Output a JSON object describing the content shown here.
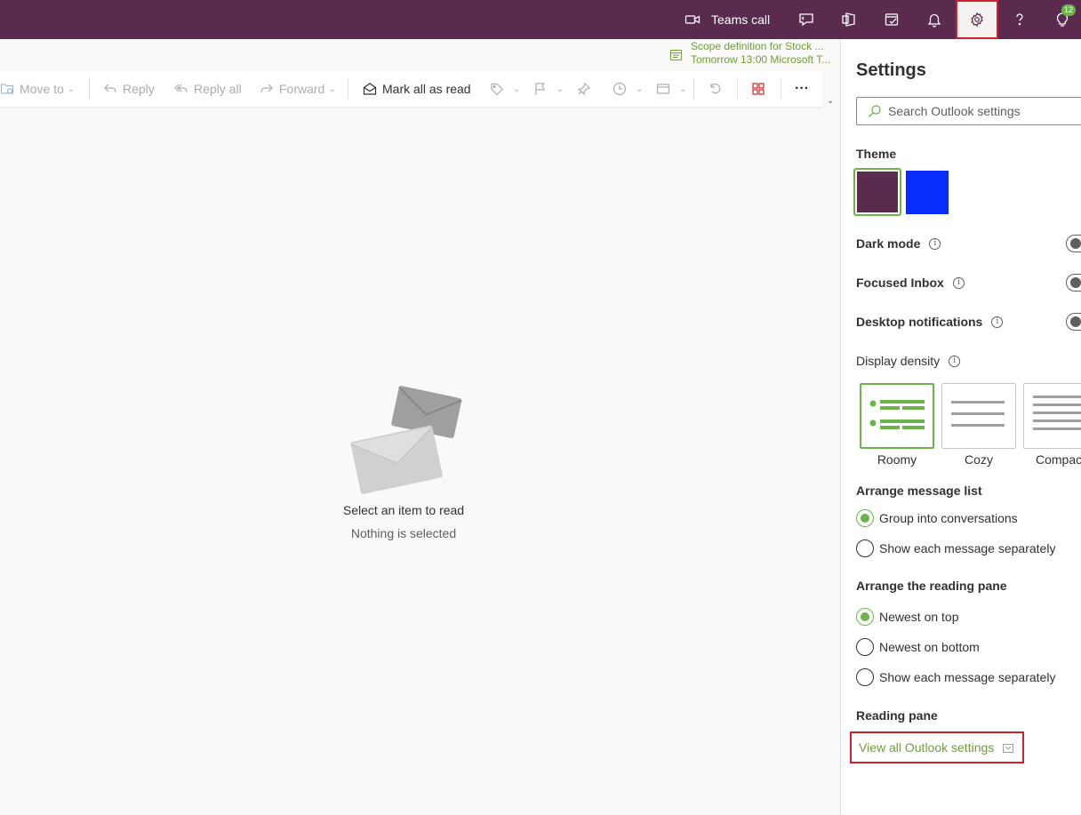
{
  "topbar": {
    "teams_call_label": "Teams call",
    "notification_badge": "12",
    "icons": [
      "video-camera-icon",
      "feedback-icon",
      "office-icon",
      "tasks-icon",
      "bell-icon",
      "gear-icon",
      "help-icon",
      "lightbulb-icon"
    ]
  },
  "reminder": {
    "title": "Scope definition for Stock ...",
    "subtitle": "Tomorrow 13:00 Microsoft T..."
  },
  "toolbar": {
    "move_to": "Move to",
    "reply": "Reply",
    "reply_all": "Reply all",
    "forward": "Forward",
    "mark_all_read": "Mark all as read",
    "more": "···"
  },
  "reading_pane": {
    "title": "Select an item to read",
    "subtitle": "Nothing is selected"
  },
  "settings": {
    "title": "Settings",
    "search_placeholder": "Search Outlook settings",
    "theme_label": "Theme",
    "themes": [
      {
        "color": "#5a2a4f",
        "selected": true
      },
      {
        "color": "#0a2dff",
        "selected": false
      }
    ],
    "dark_mode": "Dark mode",
    "focused_inbox": "Focused Inbox",
    "desktop_notifications": "Desktop notifications",
    "display_density": "Display density",
    "density_options": [
      "Roomy",
      "Cozy",
      "Compact"
    ],
    "arrange_message_list": "Arrange message list",
    "message_list_options": [
      "Group into conversations",
      "Show each message separately"
    ],
    "arrange_reading_pane": "Arrange the reading pane",
    "reading_pane_options": [
      "Newest on top",
      "Newest on bottom",
      "Show each message separately"
    ],
    "reading_pane_label": "Reading pane",
    "view_all": "View all Outlook settings",
    "info_glyph": "i"
  },
  "colors": {
    "brand": "#5a2a4f",
    "accent": "#6bb44a",
    "highlight": "#d1202e"
  }
}
